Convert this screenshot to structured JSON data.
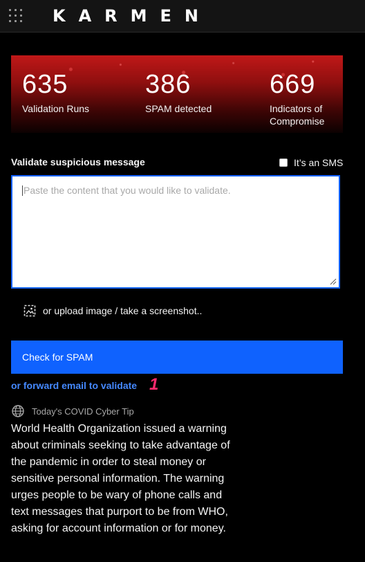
{
  "header": {
    "app_name": "KARMEN",
    "menu_icon": "app-grid-icon"
  },
  "stats": [
    {
      "value": "635",
      "label": "Validation Runs"
    },
    {
      "value": "386",
      "label": "SPAM detected"
    },
    {
      "value": "669",
      "label": "Indicators of Compromise"
    }
  ],
  "form": {
    "label": "Validate suspicious message",
    "sms_label": "It’s an SMS",
    "sms_checked": false,
    "textarea_placeholder": "Paste the content that you would like to validate.",
    "textarea_value": "",
    "upload_label": "or upload image / take a screenshot..",
    "upload_icon": "image-upload-icon",
    "submit_label": "Check for SPAM",
    "forward_label": "or forward email to validate",
    "badge": "1"
  },
  "tip": {
    "icon": "globe-icon",
    "heading": "Today's COVID Cyber Tip",
    "body": "World Health Organization issued a warning about criminals seeking to take advantage of the pandemic in order to steal money or sensitive personal information. The warning urges people to be wary of phone calls and text messages that purport to be from WHO, asking for account information or for money."
  },
  "colors": {
    "accent": "#0f62fe",
    "link": "#4589ff",
    "badge": "#ff2a6d",
    "banner": "#c01818"
  }
}
